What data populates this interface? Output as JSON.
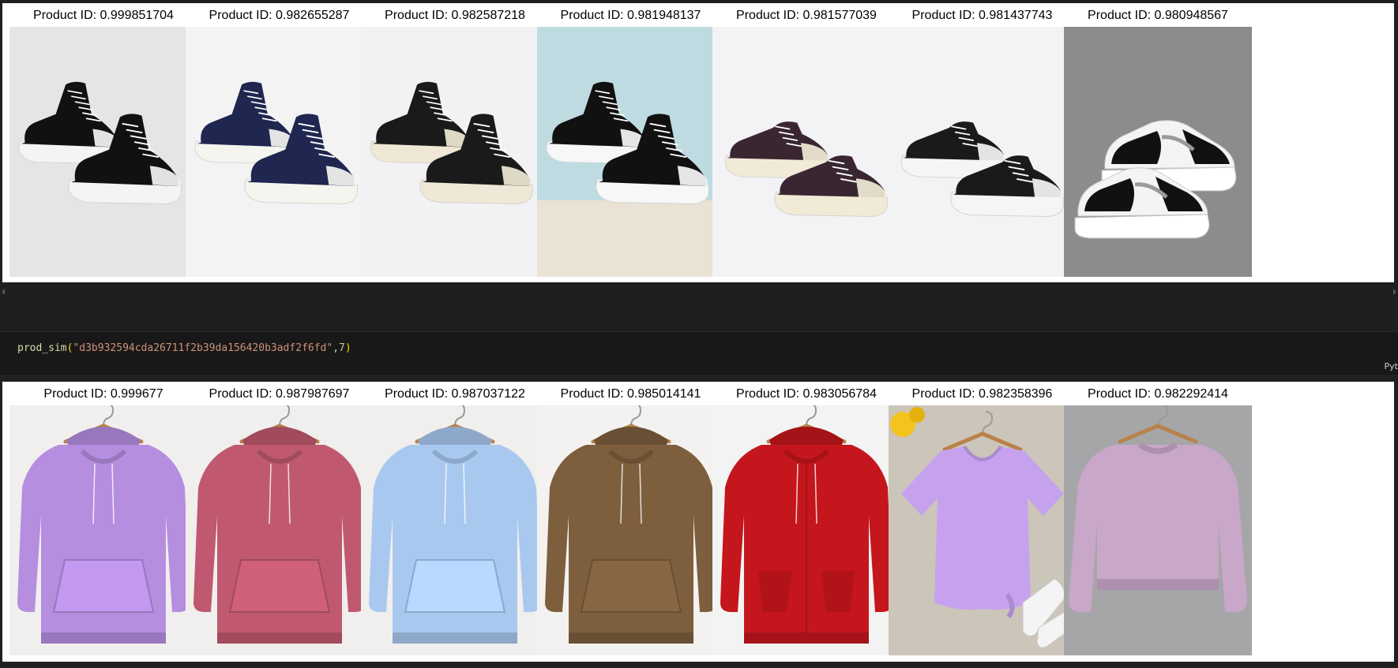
{
  "outputs": [
    {
      "items": [
        {
          "title": "Product ID: 0.999851704",
          "kind": "shoe-boot",
          "bg": "#e5e5e5",
          "main": "#111111",
          "sole": "#f4f4f4"
        },
        {
          "title": "Product ID: 0.982655287",
          "kind": "shoe-high",
          "bg": "#f3f3f3",
          "main": "#1f2650",
          "sole": "#f5f5f0"
        },
        {
          "title": "Product ID: 0.982587218",
          "kind": "shoe-high",
          "bg": "#f2f2f4",
          "main": "#1a1a1a",
          "sole": "#efe8d6"
        },
        {
          "title": "Product ID: 0.981948137",
          "kind": "shoe-high",
          "bg": "#bfdbe2",
          "main": "#111111",
          "sole": "#f7f7f7",
          "floor": "#eae2d4"
        },
        {
          "title": "Product ID: 0.981577039",
          "kind": "shoe-low",
          "bg": "#f3f3f5",
          "main": "#3a2631",
          "sole": "#f1ead7"
        },
        {
          "title": "Product ID: 0.981437743",
          "kind": "shoe-low",
          "bg": "#f3f3f5",
          "main": "#1a1a1a",
          "sole": "#f5f5f5"
        },
        {
          "title": "Product ID: 0.980948567",
          "kind": "shoe-sneaker",
          "bg": "#8b8c8e",
          "main": "#111111",
          "sole": "#ffffff"
        }
      ]
    },
    {
      "items": [
        {
          "title": "Product ID: 0.999677",
          "kind": "hoodie",
          "bg": "#f1efed",
          "main": "#b58ee0"
        },
        {
          "title": "Product ID: 0.987987697",
          "kind": "hoodie",
          "bg": "#f1efed",
          "main": "#c0596f"
        },
        {
          "title": "Product ID: 0.987037122",
          "kind": "hoodie",
          "bg": "#f1efed",
          "main": "#a9c8ef"
        },
        {
          "title": "Product ID: 0.985014141",
          "kind": "hoodie",
          "bg": "#f3f2f0",
          "main": "#7d5e3d"
        },
        {
          "title": "Product ID: 0.983056784",
          "kind": "zip-hoodie",
          "bg": "#f3f3f3",
          "main": "#c4161c"
        },
        {
          "title": "Product ID: 0.982358396",
          "kind": "tshirt",
          "bg": "#ccc5ba",
          "main": "#c6a2ee"
        },
        {
          "title": "Product ID: 0.982292414",
          "kind": "sweater",
          "bg": "#a6a6a8",
          "main": "#c8a7c9"
        }
      ]
    }
  ],
  "code_cell": {
    "fn": "prod_sim",
    "open": "(",
    "arg_string": "\"d3b932594cda26711f2b39da156420b3adf2f6fd\"",
    "comma": ",",
    "arg_num": "7",
    "close": ")",
    "lang": "Pyt"
  }
}
